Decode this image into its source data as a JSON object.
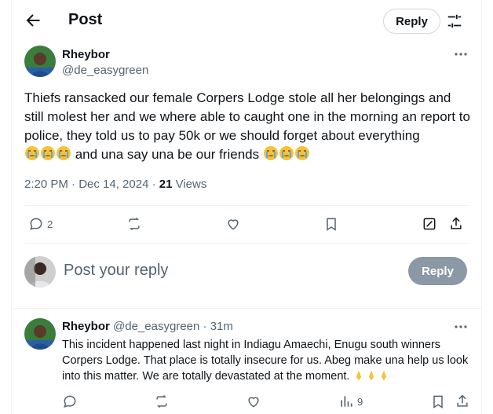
{
  "header": {
    "title": "Post",
    "reply_label": "Reply"
  },
  "post": {
    "author_name": "Rheybor",
    "author_handle": "@de_easygreen",
    "text_main": "Thiefs ransacked our female Corpers Lodge stole all her belongings and still molest her and we where able to caught one in the morning an report to police, they told us to pay 50k or we should forget about everything",
    "text_after_emoji": " and una say una be our friends ",
    "timestamp": "2:20 PM · Dec 14, 2024 · ",
    "views_count": "21",
    "views_label": " Views",
    "reply_count": "2"
  },
  "composer": {
    "placeholder": "Post your reply",
    "reply_label": "Reply"
  },
  "comment": {
    "author_name": "Rheybor",
    "author_handle": "@de_easygreen",
    "time": " · 31m",
    "text": "This incident happened last night in Indiagu Amaechi, Enugu south winners Corpers Lodge. That place is totally insecure for us. Abeg make una help us look into this matter. We are totally devastated at the moment. ",
    "views_count": "9"
  },
  "colors": {
    "text": "#0f1419",
    "muted": "#536471",
    "divider": "#eff3f4",
    "reply_disabled": "#8b98a5"
  }
}
